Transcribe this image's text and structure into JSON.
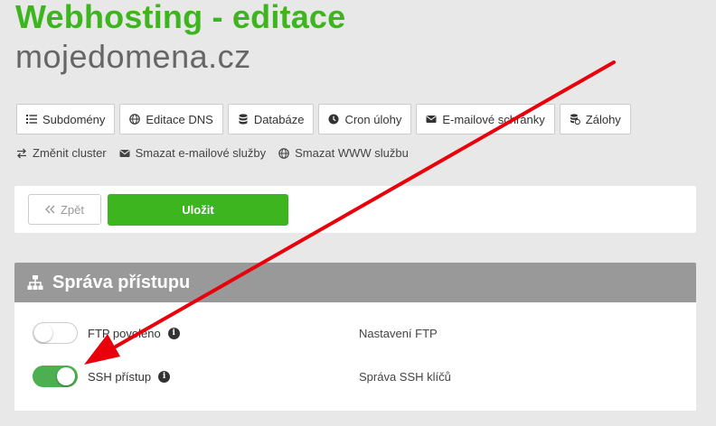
{
  "header": {
    "title": "Webhosting - editace",
    "domain": "mojedomena.cz"
  },
  "tabs": [
    {
      "label": "Subdomény",
      "icon": "list-icon"
    },
    {
      "label": "Editace DNS",
      "icon": "globe-icon"
    },
    {
      "label": "Databáze",
      "icon": "database-icon"
    },
    {
      "label": "Cron úlohy",
      "icon": "clock-icon"
    },
    {
      "label": "E-mailové schránky",
      "icon": "envelope-icon"
    },
    {
      "label": "Zálohy",
      "icon": "backup-icon"
    }
  ],
  "links": [
    {
      "label": "Změnit cluster",
      "icon": "exchange-icon"
    },
    {
      "label": "Smazat e-mailové služby",
      "icon": "envelope-icon"
    },
    {
      "label": "Smazat WWW službu",
      "icon": "globe-icon"
    }
  ],
  "actions": {
    "back_label": "Zpět",
    "save_label": "Uložit"
  },
  "section": {
    "title": "Správa přístupu",
    "icon": "sitemap-icon",
    "rows": [
      {
        "label": "FTP povoleno",
        "enabled": false,
        "link": "Nastavení FTP"
      },
      {
        "label": "SSH přístup",
        "enabled": true,
        "link": "Správa SSH klíčů"
      }
    ]
  },
  "colors": {
    "brand_green": "#3db51f",
    "toggle_on": "#4caf50",
    "section_header": "#999999",
    "annotation_arrow": "#e8000b"
  }
}
